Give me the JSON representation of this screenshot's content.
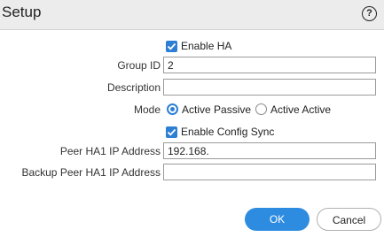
{
  "dialog": {
    "title": "Setup",
    "help_symbol": "?"
  },
  "form": {
    "enable_ha_label": "Enable HA",
    "enable_ha_checked": true,
    "group_id_label": "Group ID",
    "group_id_value": "2",
    "description_label": "Description",
    "description_value": "",
    "mode_label": "Mode",
    "mode_options": [
      "Active Passive",
      "Active Active"
    ],
    "mode_selected": "Active Passive",
    "enable_config_sync_label": "Enable Config Sync",
    "enable_config_sync_checked": true,
    "peer_ha1_label": "Peer HA1 IP Address",
    "peer_ha1_value": "192.168.",
    "backup_peer_ha1_label": "Backup Peer HA1 IP Address",
    "backup_peer_ha1_value": ""
  },
  "buttons": {
    "ok_label": "OK",
    "cancel_label": "Cancel"
  },
  "colors": {
    "accent": "#2d7fd3",
    "ok_button": "#2d8ce0",
    "titlebar": "#ececec"
  },
  "icons": {
    "help": "question-circle-icon",
    "checkmark": "checkmark-icon"
  }
}
